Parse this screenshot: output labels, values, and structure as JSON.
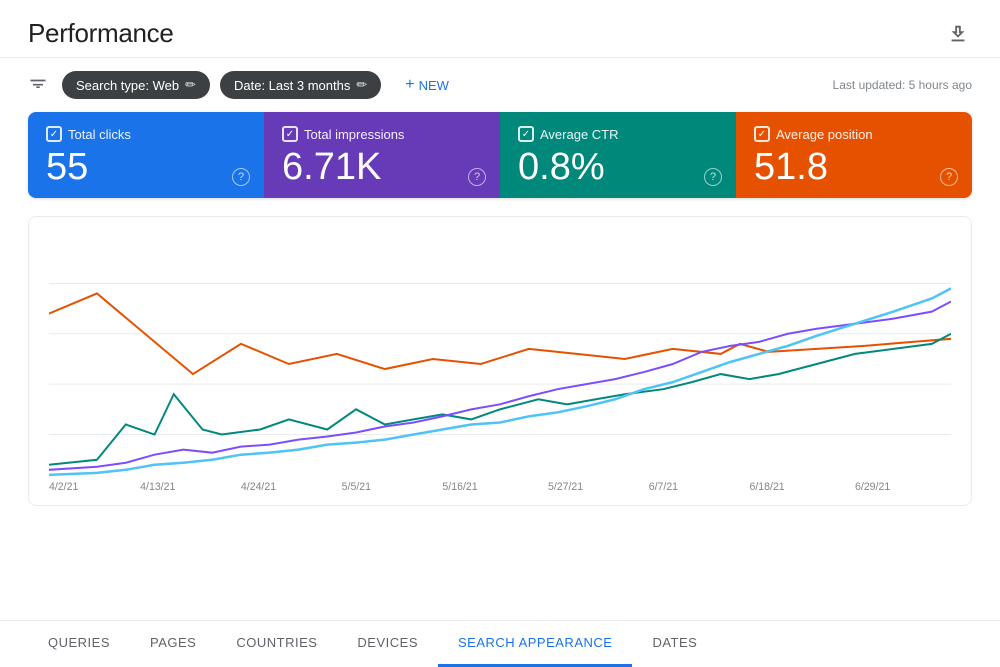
{
  "header": {
    "title": "Performance",
    "last_updated": "Last updated: 5 hours ago"
  },
  "toolbar": {
    "search_type_label": "Search type: Web",
    "date_label": "Date: Last 3 months",
    "new_label": "+ NEW"
  },
  "metrics": [
    {
      "id": "total-clicks",
      "label": "Total clicks",
      "value": "55",
      "color": "blue"
    },
    {
      "id": "total-impressions",
      "label": "Total impressions",
      "value": "6.71K",
      "color": "purple"
    },
    {
      "id": "average-ctr",
      "label": "Average CTR",
      "value": "0.8%",
      "color": "teal"
    },
    {
      "id": "average-position",
      "label": "Average position",
      "value": "51.8",
      "color": "orange"
    }
  ],
  "chart": {
    "x_labels": [
      "4/2/21",
      "4/13/21",
      "4/24/21",
      "5/5/21",
      "5/16/21",
      "5/27/21",
      "6/7/21",
      "6/18/21",
      "6/29/21"
    ]
  },
  "tabs": [
    {
      "id": "queries",
      "label": "QUERIES",
      "active": false
    },
    {
      "id": "pages",
      "label": "PAGES",
      "active": false
    },
    {
      "id": "countries",
      "label": "COUNTRIES",
      "active": false
    },
    {
      "id": "devices",
      "label": "DEVICES",
      "active": false
    },
    {
      "id": "search-appearance",
      "label": "SEARCH APPEARANCE",
      "active": true
    },
    {
      "id": "dates",
      "label": "DATES",
      "active": false
    }
  ],
  "colors": {
    "blue_line": "#4285f4",
    "purple_line": "#7c4dff",
    "teal_line": "#00897b",
    "orange_line": "#e65100",
    "accent": "#1a73e8"
  }
}
